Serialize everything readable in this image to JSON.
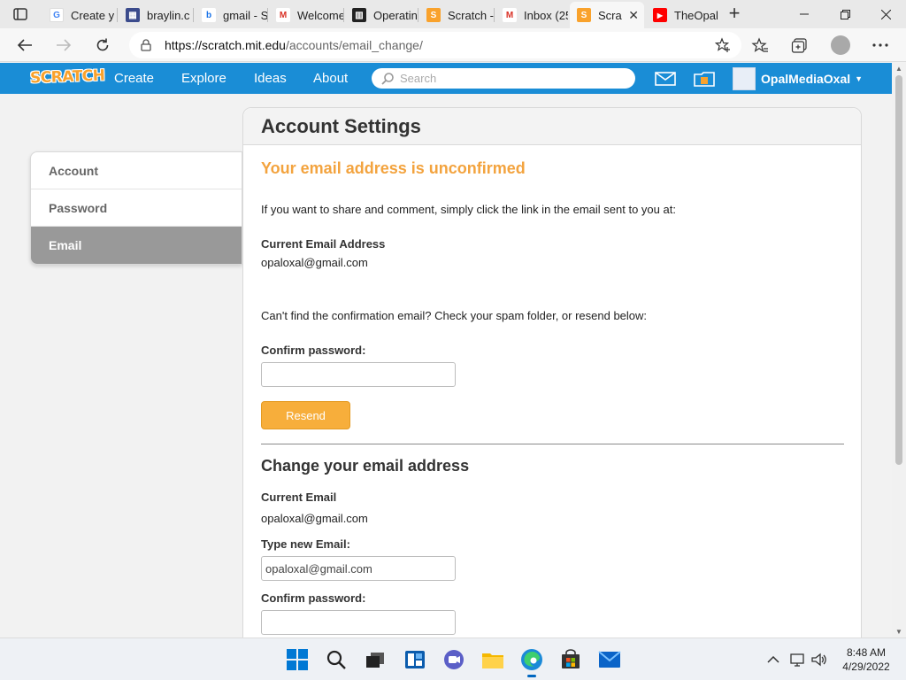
{
  "browser": {
    "tabs": [
      {
        "label": "Create y",
        "favicon": "google-icon"
      },
      {
        "label": "braylin.c",
        "favicon": "forms-icon"
      },
      {
        "label": "gmail - S",
        "favicon": "bing-icon"
      },
      {
        "label": "Welcome",
        "favicon": "gmail-icon"
      },
      {
        "label": "Operatin",
        "favicon": "book-icon"
      },
      {
        "label": "Scratch -",
        "favicon": "scratch-icon"
      },
      {
        "label": "Inbox (25",
        "favicon": "gmail-icon"
      },
      {
        "label": "Scra",
        "favicon": "scratch-icon",
        "active": true
      },
      {
        "label": "TheOpal",
        "favicon": "youtube-icon"
      }
    ],
    "new_tab": "+",
    "url_host": "https://scratch.mit.edu",
    "url_path": "/accounts/email_change/"
  },
  "scratch_nav": {
    "logo": "SCRATCH",
    "links": [
      "Create",
      "Explore",
      "Ideas",
      "About"
    ],
    "search_placeholder": "Search",
    "username": "OpalMediaOxal"
  },
  "sidebar": {
    "items": [
      {
        "label": "Account"
      },
      {
        "label": "Password"
      },
      {
        "label": "Email",
        "active": true
      }
    ]
  },
  "main": {
    "title": "Account Settings",
    "unconfirmed_heading": "Your email address is unconfirmed",
    "unconfirmed_text": "If you want to share and comment, simply click the link in the email sent to you at:",
    "current_email_label": "Current Email Address",
    "current_email_value": "opaloxal@gmail.com",
    "resend_hint": "Can't find the confirmation email? Check your spam folder, or resend below:",
    "confirm_password_label": "Confirm password:",
    "resend_button": "Resend",
    "change_heading": "Change your email address",
    "current_email_label2": "Current Email",
    "current_email_value2": "opaloxal@gmail.com",
    "new_email_label": "Type new Email:",
    "new_email_value": "opaloxal@gmail.com",
    "confirm_password_label2": "Confirm password:"
  },
  "taskbar": {
    "time": "8:48 AM",
    "date": "4/29/2022"
  },
  "colors": {
    "scratch_blue": "#1a8dd6",
    "warning_orange": "#f3a33e",
    "resend_orange": "#f7ae3b"
  }
}
